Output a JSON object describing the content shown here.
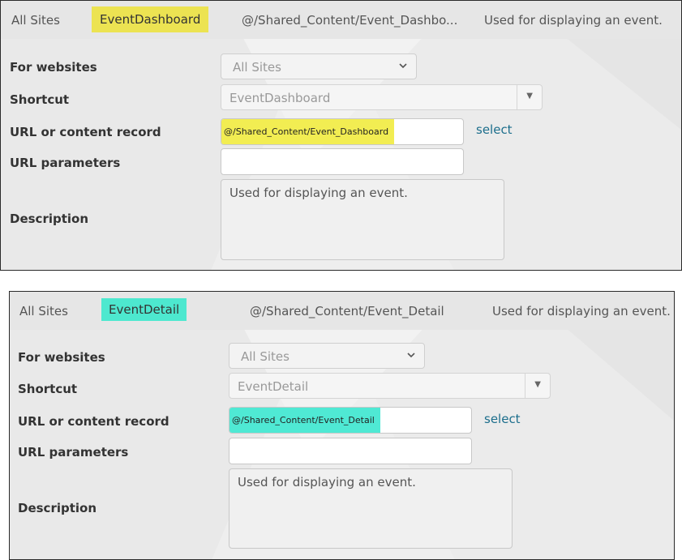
{
  "panels": [
    {
      "row": {
        "site": "All Sites",
        "shortcut": "EventDashboard",
        "url": "@/Shared_Content/Event_Dashbo...",
        "description": "Used for displaying an event."
      },
      "form": {
        "websites_label": "For websites",
        "websites_value": "All Sites",
        "shortcut_label": "Shortcut",
        "shortcut_value": "EventDashboard",
        "url_label": "URL or content record",
        "url_value": "@/Shared_Content/Event_Dashboard",
        "select_link": "select",
        "params_label": "URL parameters",
        "params_value": "",
        "description_label": "Description",
        "description_value": "Used for displaying an event."
      }
    },
    {
      "row": {
        "site": "All Sites",
        "shortcut": "EventDetail",
        "url": "@/Shared_Content/Event_Detail",
        "description": "Used for displaying an event."
      },
      "form": {
        "websites_label": "For websites",
        "websites_value": "All Sites",
        "shortcut_label": "Shortcut",
        "shortcut_value": "EventDetail",
        "url_label": "URL or content record",
        "url_value": "@/Shared_Content/Event_Detail",
        "select_link": "select",
        "params_label": "URL parameters",
        "params_value": "",
        "description_label": "Description",
        "description_value": "Used for displaying an event."
      }
    }
  ],
  "icons": {
    "chevron": "chevron-down-icon",
    "dropdown": "triangle-down-icon"
  },
  "colors": {
    "highlight_yellow": "#ece352",
    "highlight_cyan": "#4de8cf",
    "link": "#1c6e8c"
  }
}
